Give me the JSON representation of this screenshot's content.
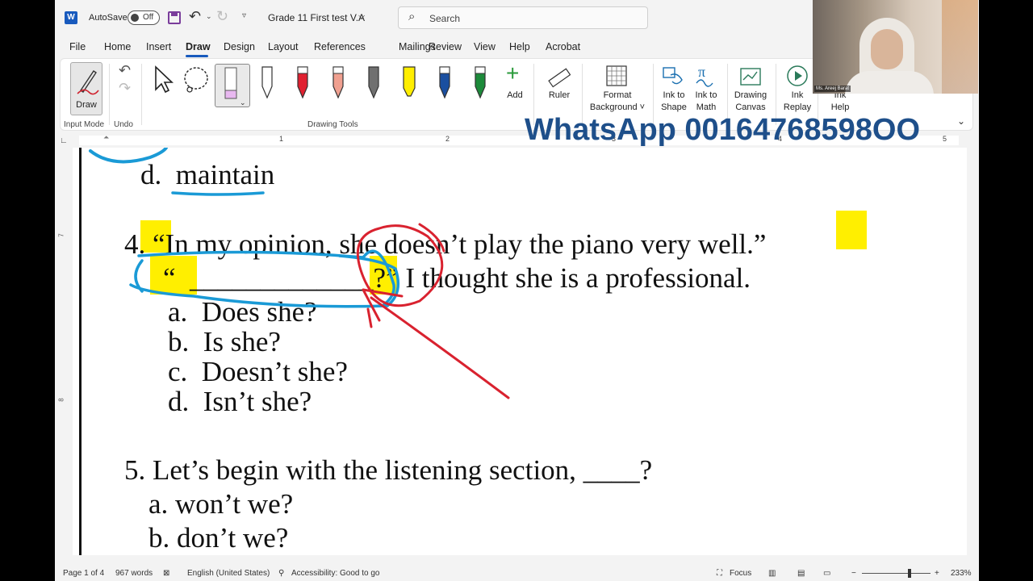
{
  "titlebar": {
    "app_badge": "W",
    "autosave_label": "AutoSave",
    "autosave_state": "Off",
    "doc_title": "Grade 11 First test V.A",
    "search_placeholder": "Search"
  },
  "tabs": [
    "File",
    "Home",
    "Insert",
    "Draw",
    "Design",
    "Layout",
    "References",
    "Mailings",
    "Review",
    "View",
    "Help",
    "Acrobat"
  ],
  "active_tab": "Draw",
  "ribbon": {
    "draw_label": "Draw",
    "input_mode_label": "Input Mode",
    "undo_label": "Undo",
    "drawing_tools_label": "Drawing Tools",
    "add_label": "Add",
    "ruler_label": "Ruler",
    "format_background_line1": "Format",
    "format_background_line2": "Background ˅",
    "ink_to_shape_line1": "Ink to",
    "ink_to_shape_line2": "Shape",
    "ink_to_math_line1": "Ink to",
    "ink_to_math_line2": "Math",
    "drawing_canvas_line1": "Drawing",
    "drawing_canvas_line2": "Canvas",
    "ink_replay_line1": "Ink",
    "ink_replay_line2": "Replay",
    "ink_help_line1": "Ink",
    "ink_help_line2": "Help",
    "pen_colors": [
      "#ffffff",
      "#e02030",
      "#f0a090",
      "#707070",
      "#ffee00",
      "#1a4fa0",
      "#1c8a3a"
    ]
  },
  "ruler": [
    "1",
    "2",
    "3",
    "4",
    "5"
  ],
  "vruler": [
    "7",
    "8"
  ],
  "watermark": "WhatsApp 00164768598OO",
  "video": {
    "name_tag": "Ms. Areej Barat"
  },
  "document": {
    "item_d_prev": "d.  maintain",
    "q4_line1": "4. “In my opinion, she doesn’t play the piano very well.”",
    "q4_line2": "“  _____________?” I thought she is a professional.",
    "q4_a": "a.  Does she?",
    "q4_b": "b.  Is she?",
    "q4_c": "c.  Doesn’t she?",
    "q4_d": "d.  Isn’t she?",
    "q5_line": "5. Let’s begin with the listening section, ____?",
    "q5_a": "a. won’t we?",
    "q5_b": "b. don’t we?"
  },
  "status": {
    "page": "Page 1 of 4",
    "words": "967 words",
    "language": "English (United States)",
    "accessibility": "Accessibility: Good to go",
    "focus": "Focus",
    "zoom": "233%"
  }
}
